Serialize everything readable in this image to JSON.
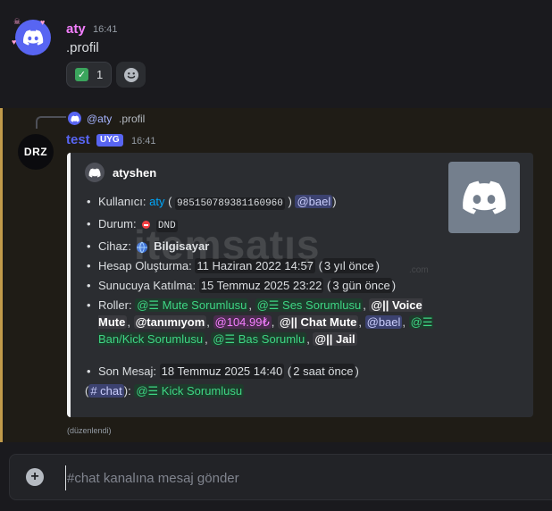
{
  "message1": {
    "author": "aty",
    "author_color": "#f47fff",
    "timestamp": "16:41",
    "content": ".profil",
    "reaction_emoji": "check-mark-icon",
    "reaction_count": "1"
  },
  "message2": {
    "reply_mention": "@aty",
    "reply_text": ".profil",
    "avatar_text": "DRZ",
    "author": "test",
    "author_color": "#5865f2",
    "badge": "UYG",
    "timestamp": "16:41",
    "embed": {
      "author": "atyshen",
      "user_label": "Kullanıcı:",
      "user_name": "aty",
      "paren_open": "(",
      "user_id": "985150789381160960",
      "paren_close": ")",
      "user_mention": "@bael",
      "status_label": "Durum:",
      "status_value": "DND",
      "device_label": "Cihaz:",
      "device_value": "Bilgisayar",
      "created_label": "Hesap Oluşturma:",
      "created_date": "11 Haziran 2022 14:57",
      "created_ago": "3 yıl önce",
      "joined_label": "Sunucuya Katılma:",
      "joined_date": "15 Temmuz 2025 23:22",
      "joined_ago": "3 gün önce",
      "roles_label": "Roller:",
      "roles": [
        "@☰ Mute Sorumlusu",
        "@☰ Ses Sorumlusu",
        "@|| Voice Mute",
        "@tanımıyom",
        "@104.99₺",
        "@|| Chat Mute",
        "@bael",
        "@☰ Ban/Kick Sorumlusu",
        "@☰ Bas Sorumlu",
        "@|| Jail"
      ],
      "last_msg_label": "Son Mesaj:",
      "last_msg_date": "18 Temmuz 2025 14:40",
      "last_msg_ago": "2 saat önce",
      "channel": "# chat",
      "channel_role": "@☰ Kick Sorumlusu"
    },
    "edited": "(düzenlendi)"
  },
  "watermark": {
    "text": "itemsatış",
    "domain": ".com"
  },
  "composer": {
    "placeholder": "#chat kanalına mesaj gönder"
  }
}
